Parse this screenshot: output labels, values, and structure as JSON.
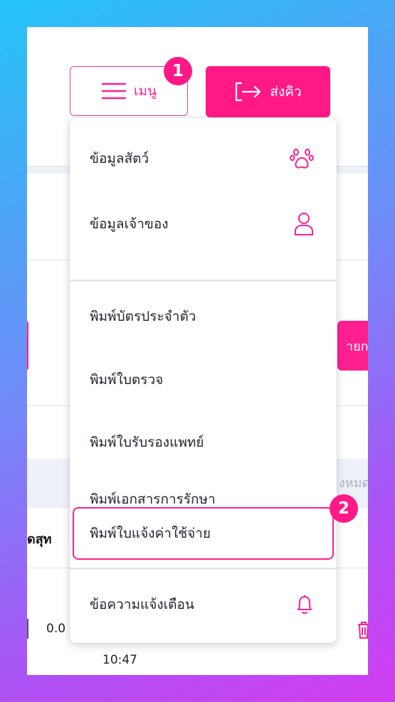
{
  "header": {
    "menu_label": "เมนู",
    "queue_label": "ส่งคิว"
  },
  "annotations": {
    "badge_one": "1",
    "badge_two": "2"
  },
  "menu": {
    "items": [
      {
        "label": "ข้อมูลสัตว์",
        "icon": "paw-icon"
      },
      {
        "label": "ข้อมูลเจ้าของ",
        "icon": "person-icon"
      },
      {
        "label": "พิมพ์บัตรประจำตัว"
      },
      {
        "label": "พิมพ์ใบตรวจ"
      },
      {
        "label": "พิมพ์ใบรับรองแพทย์"
      },
      {
        "label": "พิมพ์เอกสารการรักษา"
      },
      {
        "label": "พิมพ์ใบแจ้งค่าใช้จ่าย",
        "highlighted": true
      },
      {
        "label": "ข้อความแจ้งเตือน",
        "icon": "bell-icon"
      }
    ]
  },
  "background": {
    "right_button_fragment": "ายกา",
    "right_gray_fragment": "งหมด",
    "left_bold_fragment": "ดสุท",
    "left_number": "0.0",
    "time": "10:47"
  },
  "colors": {
    "accent": "#ff1987",
    "text": "#1f2430",
    "divider": "#e3e8f0"
  }
}
